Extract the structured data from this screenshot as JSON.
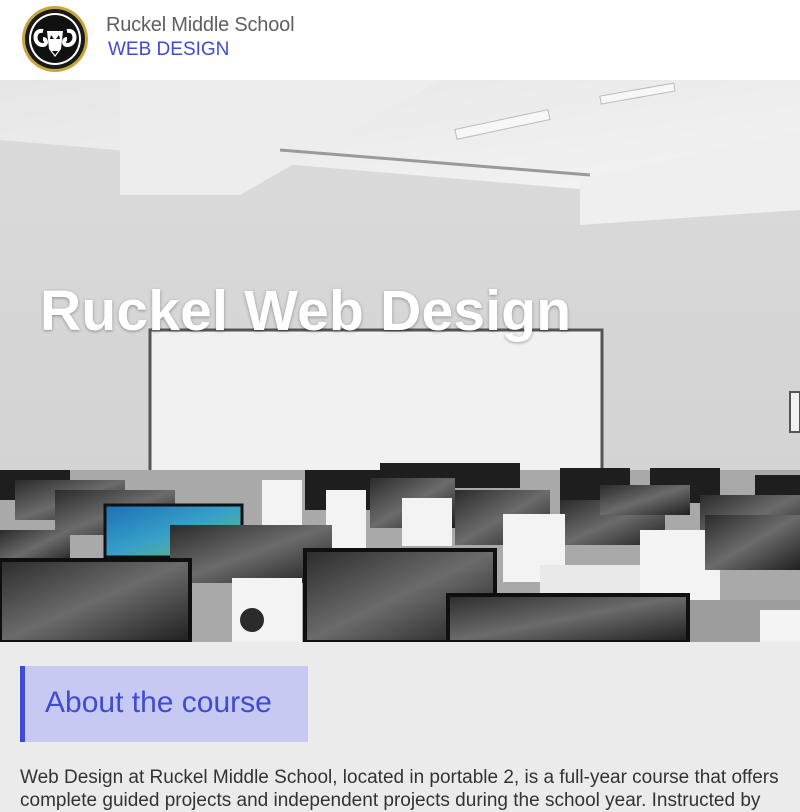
{
  "header": {
    "school_name": "Ruckel Middle School",
    "site_name": "WEB DESIGN",
    "logo_icon": "ram-logo-icon"
  },
  "hero": {
    "title": "Ruckel Web Design",
    "image": "computer-lab-photo"
  },
  "about": {
    "heading": "About the course",
    "paragraph_line1": "Web Design at Ruckel Middle School, located in portable 2, is a full-year course that offers",
    "paragraph_line2": "complete guided projects and independent projects during the school year. Instructed by"
  },
  "colors": {
    "accent": "#3f4bd0",
    "heading_bg": "#c6c9f2",
    "page_bg": "#ebebeb",
    "logo_ring": "#c8a63a"
  }
}
